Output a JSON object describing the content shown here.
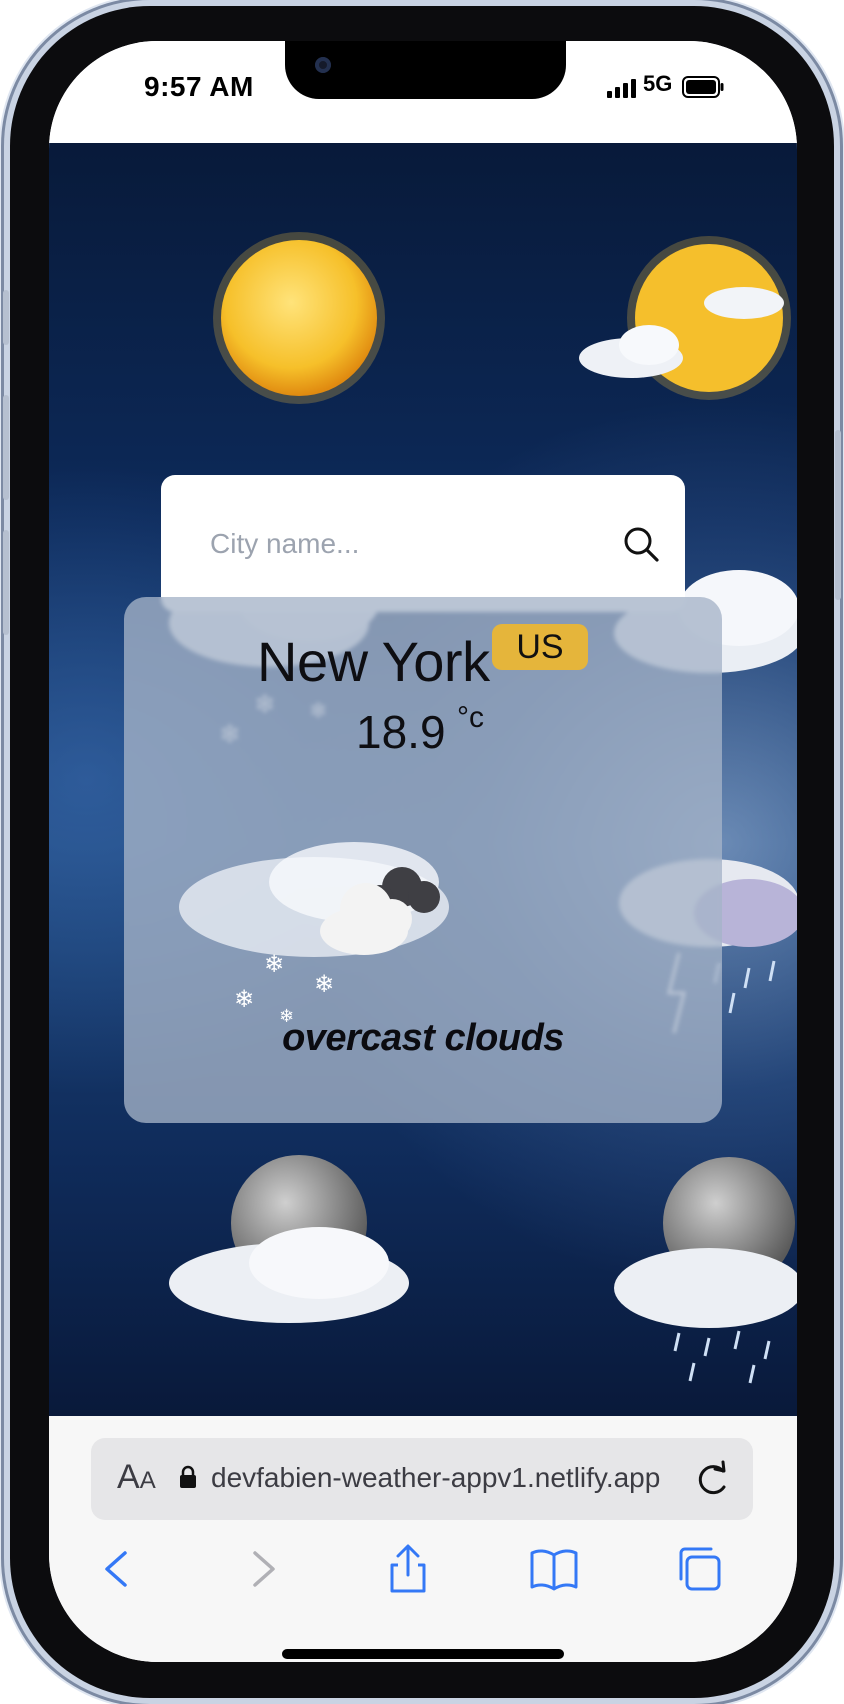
{
  "status_bar": {
    "time": "9:57 AM",
    "network": "5G",
    "icons": [
      "signal-bars-icon",
      "battery-icon"
    ]
  },
  "search": {
    "placeholder": "City name...",
    "value": "",
    "icon": "search-icon"
  },
  "weather": {
    "city": "New York",
    "country": "US",
    "temperature": "18.9",
    "unit": "°c",
    "description": "overcast clouds",
    "condition_icon": "overcast-clouds-icon"
  },
  "browser": {
    "aa_label_big": "A",
    "aa_label_small": "A",
    "url": "devfabien-weather-appv1.netlify.app",
    "icons": [
      "lock-icon",
      "reload-icon",
      "back-icon",
      "forward-icon",
      "share-icon",
      "bookmarks-icon",
      "tabs-icon"
    ]
  },
  "colors": {
    "badge": "#e5b53b",
    "card": "#a5b4c8",
    "accent": "#3478f6",
    "background": "#0d2a5a"
  }
}
